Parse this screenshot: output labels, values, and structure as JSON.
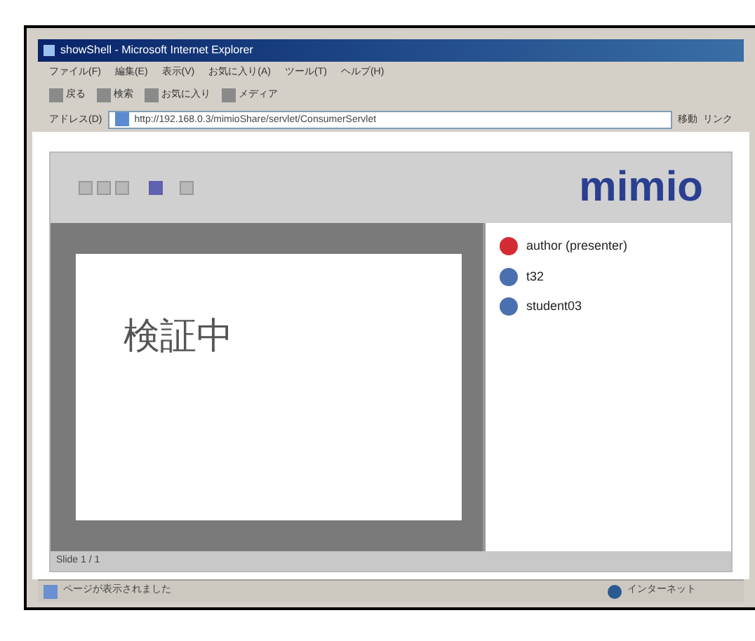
{
  "window": {
    "title": "showShell - Microsoft Internet Explorer"
  },
  "menu": [
    "ファイル(F)",
    "編集(E)",
    "表示(V)",
    "お気に入り(A)",
    "ツール(T)",
    "ヘルプ(H)"
  ],
  "toolbar": [
    "戻る",
    "検索",
    "お気に入り",
    "メディア"
  ],
  "address": {
    "label": "アドレス(D)",
    "value": "http://192.168.0.3/mimioShare/servlet/ConsumerServlet",
    "go": "移動",
    "links": "リンク"
  },
  "app": {
    "logo": "mimio",
    "whiteboard_text": "検証中",
    "slide": "Slide 1 / 1",
    "participants": [
      {
        "name": "author (presenter)",
        "color": "#d42a32"
      },
      {
        "name": "t32",
        "color": "#4a70b0"
      },
      {
        "name": "student03",
        "color": "#4a70b0"
      }
    ]
  },
  "status_bar": {
    "message": "ページが表示されました",
    "zone": "インターネット"
  }
}
